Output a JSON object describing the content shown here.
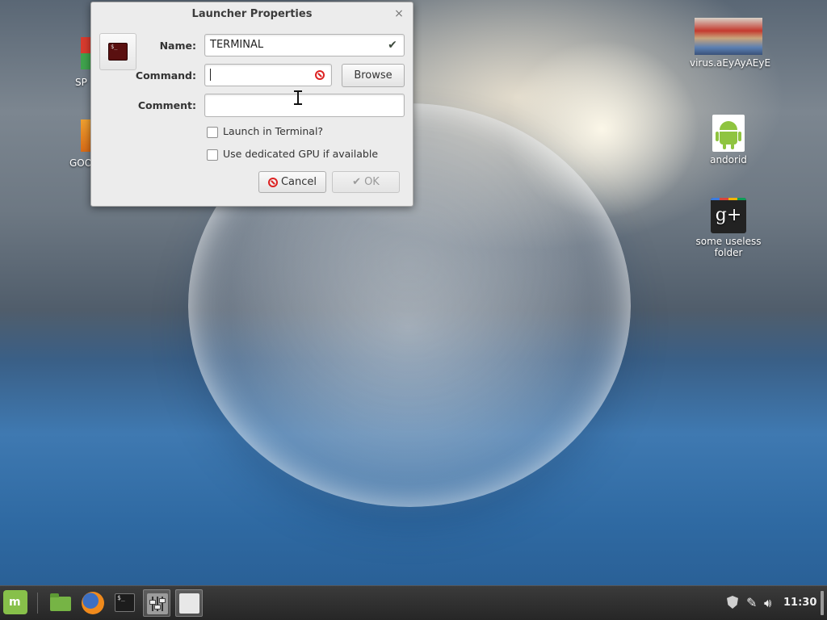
{
  "desktop": {
    "left_icons": [
      {
        "label": "SP",
        "icon": "app-icon-red-green"
      },
      {
        "label": "GOO",
        "icon": "app-icon-orange"
      }
    ],
    "right_icons": [
      {
        "label": "virus.aEyAyAEyE",
        "icon": "image-thumbnail-icon"
      },
      {
        "label": "andorid",
        "icon": "android-icon"
      },
      {
        "label": "some useless folder",
        "icon": "google-plus-icon",
        "glyph": "g+"
      }
    ]
  },
  "dialog": {
    "title": "Launcher Properties",
    "close_glyph": "×",
    "name_label": "Name:",
    "name_value": "TERMINAL",
    "command_label": "Command:",
    "command_value": "",
    "browse_label": "Browse",
    "comment_label": "Comment:",
    "comment_value": "",
    "launch_in_terminal_label": "Launch in Terminal?",
    "launch_in_terminal_checked": false,
    "dedicated_gpu_label": "Use dedicated GPU if available",
    "dedicated_gpu_checked": false,
    "cancel_label": "Cancel",
    "ok_label": "OK",
    "ok_enabled": false,
    "terminal_icon_text": "$_"
  },
  "taskbar": {
    "menu_icon": "mint-menu-icon",
    "launchers": [
      "files-icon",
      "firefox-icon",
      "terminal-icon",
      "mixer-icon",
      "launcher-properties-icon"
    ],
    "terminal_text": "$_",
    "clock": "11:30"
  },
  "colors": {
    "mint_green": "#87c04a",
    "error_red": "#dd2222",
    "android_green": "#8fc440"
  }
}
